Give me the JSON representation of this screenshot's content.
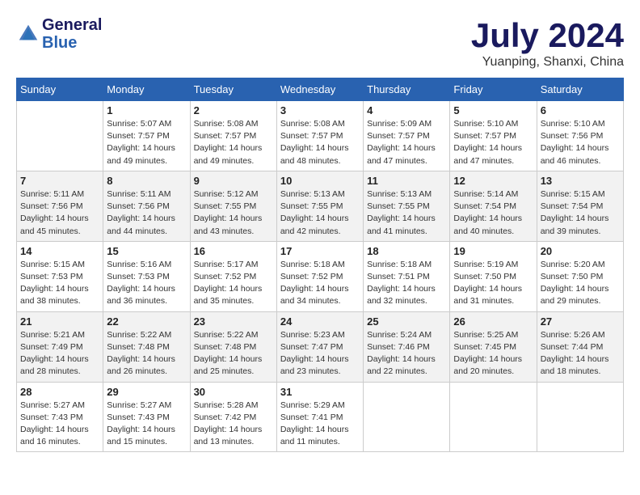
{
  "header": {
    "logo_line1": "General",
    "logo_line2": "Blue",
    "month_title": "July 2024",
    "subtitle": "Yuanping, Shanxi, China"
  },
  "days_of_week": [
    "Sunday",
    "Monday",
    "Tuesday",
    "Wednesday",
    "Thursday",
    "Friday",
    "Saturday"
  ],
  "weeks": [
    [
      {
        "day": "",
        "sunrise": "",
        "sunset": "",
        "daylight": ""
      },
      {
        "day": "1",
        "sunrise": "Sunrise: 5:07 AM",
        "sunset": "Sunset: 7:57 PM",
        "daylight": "Daylight: 14 hours and 49 minutes."
      },
      {
        "day": "2",
        "sunrise": "Sunrise: 5:08 AM",
        "sunset": "Sunset: 7:57 PM",
        "daylight": "Daylight: 14 hours and 49 minutes."
      },
      {
        "day": "3",
        "sunrise": "Sunrise: 5:08 AM",
        "sunset": "Sunset: 7:57 PM",
        "daylight": "Daylight: 14 hours and 48 minutes."
      },
      {
        "day": "4",
        "sunrise": "Sunrise: 5:09 AM",
        "sunset": "Sunset: 7:57 PM",
        "daylight": "Daylight: 14 hours and 47 minutes."
      },
      {
        "day": "5",
        "sunrise": "Sunrise: 5:10 AM",
        "sunset": "Sunset: 7:57 PM",
        "daylight": "Daylight: 14 hours and 47 minutes."
      },
      {
        "day": "6",
        "sunrise": "Sunrise: 5:10 AM",
        "sunset": "Sunset: 7:56 PM",
        "daylight": "Daylight: 14 hours and 46 minutes."
      }
    ],
    [
      {
        "day": "7",
        "sunrise": "Sunrise: 5:11 AM",
        "sunset": "Sunset: 7:56 PM",
        "daylight": "Daylight: 14 hours and 45 minutes."
      },
      {
        "day": "8",
        "sunrise": "Sunrise: 5:11 AM",
        "sunset": "Sunset: 7:56 PM",
        "daylight": "Daylight: 14 hours and 44 minutes."
      },
      {
        "day": "9",
        "sunrise": "Sunrise: 5:12 AM",
        "sunset": "Sunset: 7:55 PM",
        "daylight": "Daylight: 14 hours and 43 minutes."
      },
      {
        "day": "10",
        "sunrise": "Sunrise: 5:13 AM",
        "sunset": "Sunset: 7:55 PM",
        "daylight": "Daylight: 14 hours and 42 minutes."
      },
      {
        "day": "11",
        "sunrise": "Sunrise: 5:13 AM",
        "sunset": "Sunset: 7:55 PM",
        "daylight": "Daylight: 14 hours and 41 minutes."
      },
      {
        "day": "12",
        "sunrise": "Sunrise: 5:14 AM",
        "sunset": "Sunset: 7:54 PM",
        "daylight": "Daylight: 14 hours and 40 minutes."
      },
      {
        "day": "13",
        "sunrise": "Sunrise: 5:15 AM",
        "sunset": "Sunset: 7:54 PM",
        "daylight": "Daylight: 14 hours and 39 minutes."
      }
    ],
    [
      {
        "day": "14",
        "sunrise": "Sunrise: 5:15 AM",
        "sunset": "Sunset: 7:53 PM",
        "daylight": "Daylight: 14 hours and 38 minutes."
      },
      {
        "day": "15",
        "sunrise": "Sunrise: 5:16 AM",
        "sunset": "Sunset: 7:53 PM",
        "daylight": "Daylight: 14 hours and 36 minutes."
      },
      {
        "day": "16",
        "sunrise": "Sunrise: 5:17 AM",
        "sunset": "Sunset: 7:52 PM",
        "daylight": "Daylight: 14 hours and 35 minutes."
      },
      {
        "day": "17",
        "sunrise": "Sunrise: 5:18 AM",
        "sunset": "Sunset: 7:52 PM",
        "daylight": "Daylight: 14 hours and 34 minutes."
      },
      {
        "day": "18",
        "sunrise": "Sunrise: 5:18 AM",
        "sunset": "Sunset: 7:51 PM",
        "daylight": "Daylight: 14 hours and 32 minutes."
      },
      {
        "day": "19",
        "sunrise": "Sunrise: 5:19 AM",
        "sunset": "Sunset: 7:50 PM",
        "daylight": "Daylight: 14 hours and 31 minutes."
      },
      {
        "day": "20",
        "sunrise": "Sunrise: 5:20 AM",
        "sunset": "Sunset: 7:50 PM",
        "daylight": "Daylight: 14 hours and 29 minutes."
      }
    ],
    [
      {
        "day": "21",
        "sunrise": "Sunrise: 5:21 AM",
        "sunset": "Sunset: 7:49 PM",
        "daylight": "Daylight: 14 hours and 28 minutes."
      },
      {
        "day": "22",
        "sunrise": "Sunrise: 5:22 AM",
        "sunset": "Sunset: 7:48 PM",
        "daylight": "Daylight: 14 hours and 26 minutes."
      },
      {
        "day": "23",
        "sunrise": "Sunrise: 5:22 AM",
        "sunset": "Sunset: 7:48 PM",
        "daylight": "Daylight: 14 hours and 25 minutes."
      },
      {
        "day": "24",
        "sunrise": "Sunrise: 5:23 AM",
        "sunset": "Sunset: 7:47 PM",
        "daylight": "Daylight: 14 hours and 23 minutes."
      },
      {
        "day": "25",
        "sunrise": "Sunrise: 5:24 AM",
        "sunset": "Sunset: 7:46 PM",
        "daylight": "Daylight: 14 hours and 22 minutes."
      },
      {
        "day": "26",
        "sunrise": "Sunrise: 5:25 AM",
        "sunset": "Sunset: 7:45 PM",
        "daylight": "Daylight: 14 hours and 20 minutes."
      },
      {
        "day": "27",
        "sunrise": "Sunrise: 5:26 AM",
        "sunset": "Sunset: 7:44 PM",
        "daylight": "Daylight: 14 hours and 18 minutes."
      }
    ],
    [
      {
        "day": "28",
        "sunrise": "Sunrise: 5:27 AM",
        "sunset": "Sunset: 7:43 PM",
        "daylight": "Daylight: 14 hours and 16 minutes."
      },
      {
        "day": "29",
        "sunrise": "Sunrise: 5:27 AM",
        "sunset": "Sunset: 7:43 PM",
        "daylight": "Daylight: 14 hours and 15 minutes."
      },
      {
        "day": "30",
        "sunrise": "Sunrise: 5:28 AM",
        "sunset": "Sunset: 7:42 PM",
        "daylight": "Daylight: 14 hours and 13 minutes."
      },
      {
        "day": "31",
        "sunrise": "Sunrise: 5:29 AM",
        "sunset": "Sunset: 7:41 PM",
        "daylight": "Daylight: 14 hours and 11 minutes."
      },
      {
        "day": "",
        "sunrise": "",
        "sunset": "",
        "daylight": ""
      },
      {
        "day": "",
        "sunrise": "",
        "sunset": "",
        "daylight": ""
      },
      {
        "day": "",
        "sunrise": "",
        "sunset": "",
        "daylight": ""
      }
    ]
  ]
}
